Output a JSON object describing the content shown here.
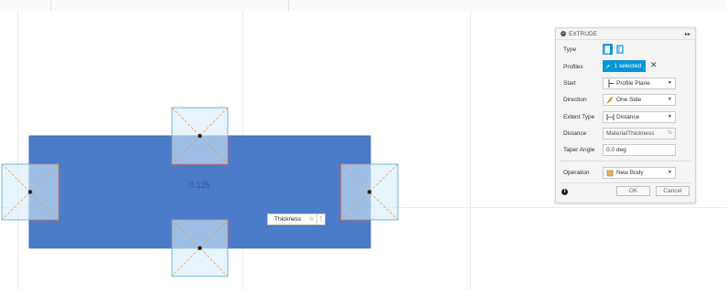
{
  "canvas": {
    "dimension_value": "0.125",
    "thickness_input": {
      "value": "Thickness",
      "fx_label": "fx",
      "more_icon": "vertical-ellipsis-icon"
    }
  },
  "panel": {
    "title": "EXTRUDE",
    "rows": {
      "type": {
        "label": "Type"
      },
      "profiles": {
        "label": "Profiles",
        "value": "1 selected"
      },
      "start": {
        "label": "Start",
        "value": "Profile Plane"
      },
      "direction": {
        "label": "Direction",
        "value": "One Side"
      },
      "extent_type": {
        "label": "Extent Type",
        "value": "Distance"
      },
      "distance": {
        "label": "Distance",
        "value": "MaterialThickness",
        "fx_label": "fx"
      },
      "taper_angle": {
        "label": "Taper Angle",
        "value": "0.0 deg"
      },
      "operation": {
        "label": "Operation",
        "value": "New Body"
      }
    },
    "ok_label": "OK",
    "cancel_label": "Cancel"
  },
  "colors": {
    "sheet_fill": "#4a7cc9",
    "profile_outline": "#d93236",
    "panel_accent": "#0696d7"
  }
}
